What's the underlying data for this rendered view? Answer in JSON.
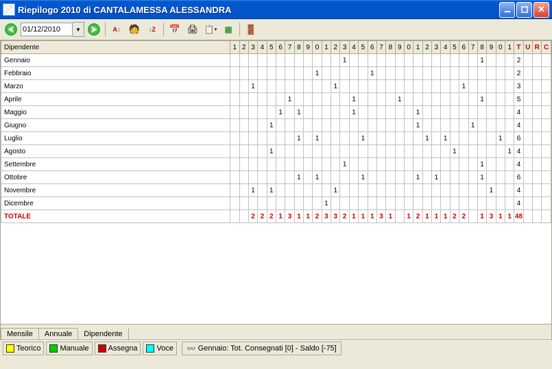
{
  "window": {
    "title": "Riepilogo 2010 di CANTALAMESSA ALESSANDRA"
  },
  "toolbar": {
    "date": "01/12/2010"
  },
  "grid": {
    "dep_header": "Dipendente",
    "day_headers": [
      "1",
      "2",
      "3",
      "4",
      "5",
      "6",
      "7",
      "8",
      "9",
      "0",
      "1",
      "2",
      "3",
      "4",
      "5",
      "6",
      "7",
      "8",
      "9",
      "0",
      "1",
      "2",
      "3",
      "4",
      "5",
      "6",
      "7",
      "8",
      "9",
      "0",
      "1"
    ],
    "sum_headers": [
      "T",
      "U",
      "R",
      "C"
    ],
    "months": [
      {
        "name": "Gennaio",
        "cells": [
          "",
          "",
          "",
          "",
          "",
          "",
          "",
          "",
          "",
          "",
          "",
          "",
          "1",
          "",
          "",
          "",
          "",
          "",
          "",
          "",
          "",
          "",
          "",
          "",
          "",
          "",
          "",
          "1",
          "",
          "",
          ""
        ],
        "T": "2"
      },
      {
        "name": "Febbraio",
        "cells": [
          "",
          "",
          "",
          "",
          "",
          "",
          "",
          "",
          "",
          "1",
          "",
          "",
          "",
          "",
          "",
          "1",
          "",
          "",
          "",
          "",
          "",
          "",
          "",
          "",
          "",
          "",
          "",
          "",
          "",
          "",
          ""
        ],
        "T": "2"
      },
      {
        "name": "Marzo",
        "cells": [
          "",
          "",
          "1",
          "",
          "",
          "",
          "",
          "",
          "",
          "",
          "",
          "1",
          "",
          "",
          "",
          "",
          "",
          "",
          "",
          "",
          "",
          "",
          "",
          "",
          "",
          "1",
          "",
          "",
          "",
          "",
          ""
        ],
        "T": "3"
      },
      {
        "name": "Aprile",
        "cells": [
          "",
          "",
          "",
          "",
          "",
          "",
          "1",
          "",
          "",
          "",
          "",
          "",
          "",
          "1",
          "",
          "",
          "",
          "",
          "1",
          "",
          "",
          "",
          "",
          "",
          "",
          "",
          "",
          "1",
          "",
          "",
          ""
        ],
        "T": "5"
      },
      {
        "name": "Maggio",
        "cells": [
          "",
          "",
          "",
          "",
          "",
          "1",
          "",
          "1",
          "",
          "",
          "",
          "",
          "",
          "1",
          "",
          "",
          "",
          "",
          "",
          "",
          "1",
          "",
          "",
          "",
          "",
          "",
          "",
          "",
          "",
          "",
          ""
        ],
        "T": "4"
      },
      {
        "name": "Giugno",
        "cells": [
          "",
          "",
          "",
          "",
          "1",
          "",
          "",
          "",
          "",
          "",
          "",
          "",
          "",
          "",
          "",
          "",
          "",
          "",
          "",
          "",
          "1",
          "",
          "",
          "",
          "",
          "",
          "1",
          "",
          "",
          "",
          ""
        ],
        "T": "4"
      },
      {
        "name": "Luglio",
        "cells": [
          "",
          "",
          "",
          "",
          "",
          "",
          "",
          "1",
          "",
          "1",
          "",
          "",
          "",
          "",
          "1",
          "",
          "",
          "",
          "",
          "",
          "",
          "1",
          "",
          "1",
          "",
          "",
          "",
          "",
          "",
          "1",
          ""
        ],
        "T": "6"
      },
      {
        "name": "Agosto",
        "cells": [
          "",
          "",
          "",
          "",
          "1",
          "",
          "",
          "",
          "",
          "",
          "",
          "",
          "",
          "",
          "",
          "",
          "",
          "",
          "",
          "",
          "",
          "",
          "",
          "",
          "1",
          "",
          "",
          "",
          "",
          "",
          "1"
        ],
        "T": "4"
      },
      {
        "name": "Settembre",
        "cells": [
          "",
          "",
          "",
          "",
          "",
          "",
          "",
          "",
          "",
          "",
          "",
          "",
          "1",
          "",
          "",
          "",
          "",
          "",
          "",
          "",
          "",
          "",
          "",
          "",
          "",
          "",
          "",
          "1",
          "",
          "",
          ""
        ],
        "T": "4"
      },
      {
        "name": "Ottobre",
        "cells": [
          "",
          "",
          "",
          "",
          "",
          "",
          "",
          "1",
          "",
          "1",
          "",
          "",
          "",
          "",
          "1",
          "",
          "",
          "",
          "",
          "",
          "1",
          "",
          "1",
          "",
          "",
          "",
          "",
          "1",
          "",
          "",
          ""
        ],
        "T": "6"
      },
      {
        "name": "Novembre",
        "cells": [
          "",
          "",
          "1",
          "",
          "1",
          "",
          "",
          "",
          "",
          "",
          "",
          "1",
          "",
          "",
          "",
          "",
          "",
          "",
          "",
          "",
          "",
          "",
          "",
          "",
          "",
          "",
          "",
          "",
          "1",
          "",
          ""
        ],
        "T": "4"
      },
      {
        "name": "Dicembre",
        "cells": [
          "",
          "",
          "",
          "",
          "",
          "",
          "",
          "",
          "",
          "",
          "1",
          "",
          "",
          "",
          "",
          "",
          "",
          "",
          "",
          "",
          "",
          "",
          "",
          "",
          "",
          "",
          "",
          "",
          "",
          "",
          ""
        ],
        "T": "4"
      },
      {
        "name": "TOTALE",
        "cells": [
          "",
          "",
          "2",
          "2",
          "2",
          "1",
          "3",
          "1",
          "1",
          "2",
          "3",
          "3",
          "2",
          "1",
          "1",
          "1",
          "3",
          "1",
          "",
          "1",
          "2",
          "1",
          "1",
          "1",
          "2",
          "2",
          "",
          "1",
          "3",
          "1",
          "1"
        ],
        "T": "48",
        "total": true
      }
    ]
  },
  "tabs": {
    "mensile": "Mensile",
    "annuale": "Annuale",
    "dipendente": "Dipendente"
  },
  "legend": {
    "teorico": "Teorico",
    "manuale": "Manuale",
    "assegna": "Assegna",
    "voce": "Voce"
  },
  "status": "Gennaio: Tot. Consegnati [0] - Saldo [-75]"
}
